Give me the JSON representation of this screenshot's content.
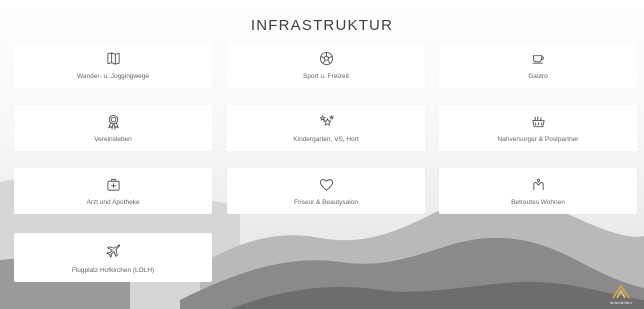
{
  "header": {
    "title": "INFRASTRUKTUR"
  },
  "tiles": [
    {
      "label": "Wander- u. Joggingwege",
      "icon": "map-icon"
    },
    {
      "label": "Sport u. Freizeit",
      "icon": "soccer-ball-icon"
    },
    {
      "label": "Gastro",
      "icon": "coffee-cup-icon"
    },
    {
      "label": "Vereinsleben",
      "icon": "award-ribbon-icon"
    },
    {
      "label": "Kindergarten, VS, Hort",
      "icon": "stars-icon"
    },
    {
      "label": "Nahversorger & Postpartner",
      "icon": "shopping-basket-icon"
    },
    {
      "label": "Arzt und Apotheke",
      "icon": "first-aid-kit-icon"
    },
    {
      "label": "Friseur & Beautysalon",
      "icon": "heart-icon"
    },
    {
      "label": "Betreutes Wohnen",
      "icon": "caring-hands-icon"
    },
    {
      "label": "Flugplatz Hofkirchen (LOLH)",
      "icon": "airplane-icon"
    }
  ],
  "logo": {
    "text": "immobilien",
    "color": "#c9a449"
  },
  "colors": {
    "background": "#f4f4f4",
    "tile": "#ffffff",
    "mountain": "#7a7a7a"
  }
}
